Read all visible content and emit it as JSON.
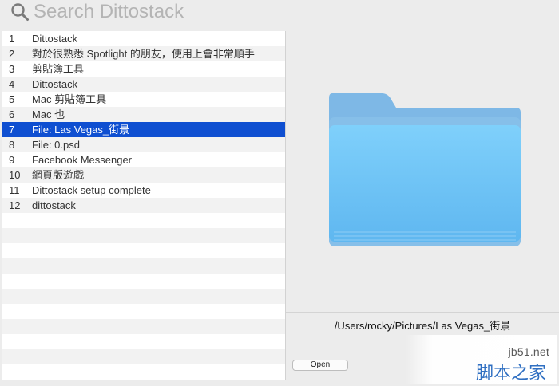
{
  "search": {
    "placeholder": "Search Dittostack"
  },
  "list": {
    "items": [
      {
        "num": "1",
        "text": "Dittostack",
        "selected": false
      },
      {
        "num": "2",
        "text": "對於很熟悉 Spotlight 的朋友，使用上會非常順手",
        "selected": false
      },
      {
        "num": "3",
        "text": "剪貼簿工具",
        "selected": false
      },
      {
        "num": "4",
        "text": "Dittostack",
        "selected": false
      },
      {
        "num": "5",
        "text": "Mac 剪貼簿工具",
        "selected": false
      },
      {
        "num": "6",
        "text": "Mac 也",
        "selected": false
      },
      {
        "num": "7",
        "text": "File: Las Vegas_街景",
        "selected": true
      },
      {
        "num": "8",
        "text": "File: 0.psd",
        "selected": false
      },
      {
        "num": "9",
        "text": "Facebook Messenger",
        "selected": false
      },
      {
        "num": "10",
        "text": "網頁版遊戲",
        "selected": false
      },
      {
        "num": "11",
        "text": "Dittostack setup complete",
        "selected": false
      },
      {
        "num": "12",
        "text": "dittostack",
        "selected": false
      },
      {
        "num": "",
        "text": "",
        "selected": false
      },
      {
        "num": "",
        "text": "",
        "selected": false
      },
      {
        "num": "",
        "text": "",
        "selected": false
      },
      {
        "num": "",
        "text": "",
        "selected": false
      },
      {
        "num": "",
        "text": "",
        "selected": false
      },
      {
        "num": "",
        "text": "",
        "selected": false
      },
      {
        "num": "",
        "text": "",
        "selected": false
      },
      {
        "num": "",
        "text": "",
        "selected": false
      },
      {
        "num": "",
        "text": "",
        "selected": false
      },
      {
        "num": "",
        "text": "",
        "selected": false
      },
      {
        "num": "",
        "text": "",
        "selected": false
      },
      {
        "num": "",
        "text": "",
        "selected": false
      }
    ]
  },
  "preview": {
    "icon": "folder-icon",
    "path": "/Users/rocky/Pictures/Las Vegas_街景",
    "open_label": "Open"
  },
  "watermark": {
    "url": "jb51.net",
    "brand": "脚本之家"
  },
  "colors": {
    "selection": "#0f4fd1",
    "folder_back": "#7cb9ea",
    "folder_front": "#6ec4f6"
  }
}
